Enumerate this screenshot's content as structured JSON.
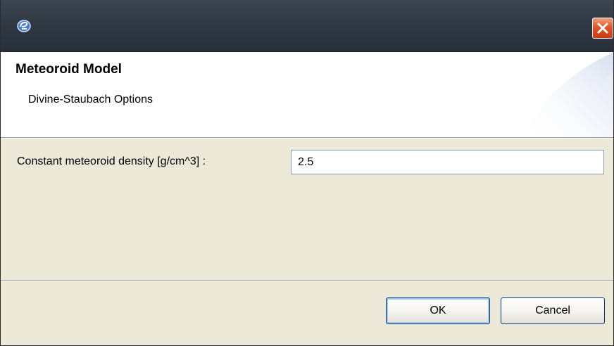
{
  "window": {
    "icon": "eclipse-app-icon",
    "close_icon": "close-icon"
  },
  "banner": {
    "title": "Meteoroid Model",
    "subtitle": "Divine-Staubach Options"
  },
  "form": {
    "density_label": "Constant meteoroid density [g/cm^3] :",
    "density_value": "2.5"
  },
  "buttons": {
    "ok_label": "OK",
    "cancel_label": "Cancel"
  },
  "colors": {
    "titlebar": "#2f3843",
    "close_button": "#e0552a",
    "dialog_background": "#ece9d8",
    "banner_background": "#ffffff"
  }
}
